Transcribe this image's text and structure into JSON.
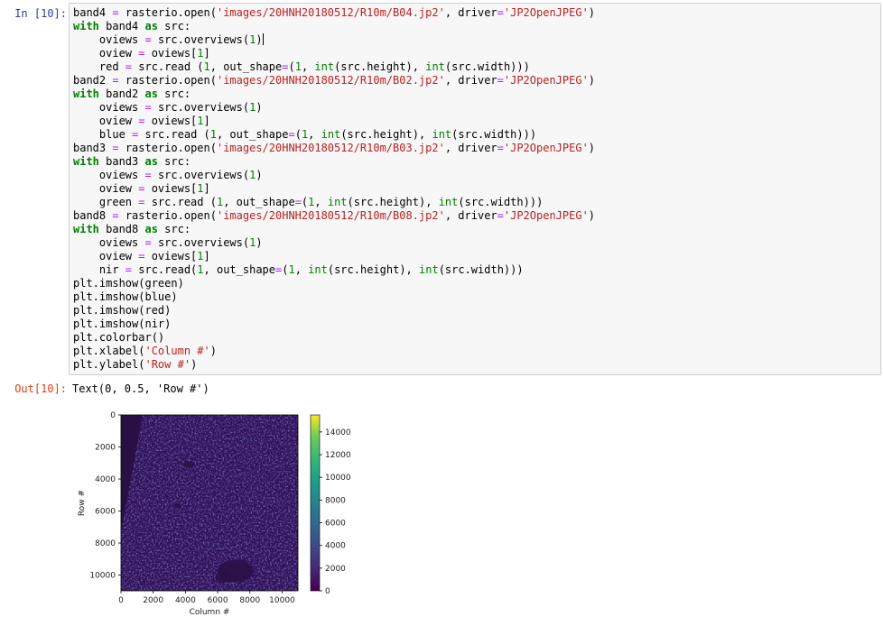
{
  "cell": {
    "in_prompt": "In [10]:",
    "out_prompt": "Out[10]:",
    "output_text": "Text(0, 0.5, 'Row #')",
    "code": [
      [
        [
          "",
          "band4 "
        ],
        [
          "o",
          "="
        ],
        [
          "",
          " rasterio.open("
        ],
        [
          "s",
          "'images/20HNH20180512/R10m/B04.jp2'"
        ],
        [
          "",
          ", driver"
        ],
        [
          "o",
          "="
        ],
        [
          "s",
          "'JP2OpenJPEG'"
        ],
        [
          "",
          ")"
        ]
      ],
      [
        [
          "k",
          "with"
        ],
        [
          "",
          " band4 "
        ],
        [
          "k",
          "as"
        ],
        [
          "",
          " src:"
        ]
      ],
      [
        [
          "",
          "    oviews "
        ],
        [
          "o",
          "="
        ],
        [
          "",
          " src.overviews("
        ],
        [
          "n",
          "1"
        ],
        [
          "",
          ")"
        ],
        [
          "cursor",
          ""
        ]
      ],
      [
        [
          "",
          "    oview "
        ],
        [
          "o",
          "="
        ],
        [
          "",
          " oviews["
        ],
        [
          "n",
          "1"
        ],
        [
          "",
          "]"
        ]
      ],
      [
        [
          "",
          "    red "
        ],
        [
          "o",
          "="
        ],
        [
          "",
          " src.read ("
        ],
        [
          "n",
          "1"
        ],
        [
          "",
          ", out_shape"
        ],
        [
          "o",
          "="
        ],
        [
          "",
          "("
        ],
        [
          "n",
          "1"
        ],
        [
          "",
          ", "
        ],
        [
          "b",
          "int"
        ],
        [
          "",
          "(src.height), "
        ],
        [
          "b",
          "int"
        ],
        [
          "",
          "(src.width)))"
        ]
      ],
      [
        [
          "",
          "band2 "
        ],
        [
          "o",
          "="
        ],
        [
          "",
          " rasterio.open("
        ],
        [
          "s",
          "'images/20HNH20180512/R10m/B02.jp2'"
        ],
        [
          "",
          ", driver"
        ],
        [
          "o",
          "="
        ],
        [
          "s",
          "'JP2OpenJPEG'"
        ],
        [
          "",
          ")"
        ]
      ],
      [
        [
          "k",
          "with"
        ],
        [
          "",
          " band2 "
        ],
        [
          "k",
          "as"
        ],
        [
          "",
          " src:"
        ]
      ],
      [
        [
          "",
          "    oviews "
        ],
        [
          "o",
          "="
        ],
        [
          "",
          " src.overviews("
        ],
        [
          "n",
          "1"
        ],
        [
          "",
          ")"
        ]
      ],
      [
        [
          "",
          "    oview "
        ],
        [
          "o",
          "="
        ],
        [
          "",
          " oviews["
        ],
        [
          "n",
          "1"
        ],
        [
          "",
          "]"
        ]
      ],
      [
        [
          "",
          "    blue "
        ],
        [
          "o",
          "="
        ],
        [
          "",
          " src.read ("
        ],
        [
          "n",
          "1"
        ],
        [
          "",
          ", out_shape"
        ],
        [
          "o",
          "="
        ],
        [
          "",
          "("
        ],
        [
          "n",
          "1"
        ],
        [
          "",
          ", "
        ],
        [
          "b",
          "int"
        ],
        [
          "",
          "(src.height), "
        ],
        [
          "b",
          "int"
        ],
        [
          "",
          "(src.width)))"
        ]
      ],
      [
        [
          "",
          "band3 "
        ],
        [
          "o",
          "="
        ],
        [
          "",
          " rasterio.open("
        ],
        [
          "s",
          "'images/20HNH20180512/R10m/B03.jp2'"
        ],
        [
          "",
          ", driver"
        ],
        [
          "o",
          "="
        ],
        [
          "s",
          "'JP2OpenJPEG'"
        ],
        [
          "",
          ")"
        ]
      ],
      [
        [
          "k",
          "with"
        ],
        [
          "",
          " band3 "
        ],
        [
          "k",
          "as"
        ],
        [
          "",
          " src:"
        ]
      ],
      [
        [
          "",
          "    oviews "
        ],
        [
          "o",
          "="
        ],
        [
          "",
          " src.overviews("
        ],
        [
          "n",
          "1"
        ],
        [
          "",
          ")"
        ]
      ],
      [
        [
          "",
          "    oview "
        ],
        [
          "o",
          "="
        ],
        [
          "",
          " oviews["
        ],
        [
          "n",
          "1"
        ],
        [
          "",
          "]"
        ]
      ],
      [
        [
          "",
          "    green "
        ],
        [
          "o",
          "="
        ],
        [
          "",
          " src.read ("
        ],
        [
          "n",
          "1"
        ],
        [
          "",
          ", out_shape"
        ],
        [
          "o",
          "="
        ],
        [
          "",
          "("
        ],
        [
          "n",
          "1"
        ],
        [
          "",
          ", "
        ],
        [
          "b",
          "int"
        ],
        [
          "",
          "(src.height), "
        ],
        [
          "b",
          "int"
        ],
        [
          "",
          "(src.width)))"
        ]
      ],
      [
        [
          "",
          "band8 "
        ],
        [
          "o",
          "="
        ],
        [
          "",
          " rasterio.open("
        ],
        [
          "s",
          "'images/20HNH20180512/R10m/B08.jp2'"
        ],
        [
          "",
          ", driver"
        ],
        [
          "o",
          "="
        ],
        [
          "s",
          "'JP2OpenJPEG'"
        ],
        [
          "",
          ")"
        ]
      ],
      [
        [
          "k",
          "with"
        ],
        [
          "",
          " band8 "
        ],
        [
          "k",
          "as"
        ],
        [
          "",
          " src:"
        ]
      ],
      [
        [
          "",
          "    oviews "
        ],
        [
          "o",
          "="
        ],
        [
          "",
          " src.overviews("
        ],
        [
          "n",
          "1"
        ],
        [
          "",
          ")"
        ]
      ],
      [
        [
          "",
          "    oview "
        ],
        [
          "o",
          "="
        ],
        [
          "",
          " oviews["
        ],
        [
          "n",
          "1"
        ],
        [
          "",
          "]"
        ]
      ],
      [
        [
          "",
          "    nir "
        ],
        [
          "o",
          "="
        ],
        [
          "",
          " src.read("
        ],
        [
          "n",
          "1"
        ],
        [
          "",
          ", out_shape"
        ],
        [
          "o",
          "="
        ],
        [
          "",
          "("
        ],
        [
          "n",
          "1"
        ],
        [
          "",
          ", "
        ],
        [
          "b",
          "int"
        ],
        [
          "",
          "(src.height), "
        ],
        [
          "b",
          "int"
        ],
        [
          "",
          "(src.width)))"
        ]
      ],
      [
        [
          "",
          "plt.imshow(green)"
        ]
      ],
      [
        [
          "",
          "plt.imshow(blue)"
        ]
      ],
      [
        [
          "",
          "plt.imshow(red)"
        ]
      ],
      [
        [
          "",
          "plt.imshow(nir)"
        ]
      ],
      [
        [
          "",
          "plt.colorbar()"
        ]
      ],
      [
        [
          "",
          "plt.xlabel("
        ],
        [
          "s",
          "'Column #'"
        ],
        [
          "",
          ")"
        ]
      ],
      [
        [
          "",
          "plt.ylabel("
        ],
        [
          "s",
          "'Row #'"
        ],
        [
          "",
          ")"
        ]
      ]
    ]
  },
  "chart_data": {
    "type": "heatmap",
    "xlabel": "Column #",
    "ylabel": "Row #",
    "xlim": [
      0,
      10980
    ],
    "ylim": [
      10980,
      0
    ],
    "x_ticks": [
      0,
      2000,
      4000,
      6000,
      8000,
      10000
    ],
    "y_ticks": [
      0,
      2000,
      4000,
      6000,
      8000,
      10000
    ],
    "colorbar": {
      "colormap": "viridis",
      "range": [
        0,
        15500
      ],
      "ticks": [
        0,
        2000,
        4000,
        6000,
        8000,
        10000,
        12000,
        14000
      ]
    },
    "colors": {
      "background_dark": "#2a0f45",
      "texture_mid": "#3b3f84",
      "texture_light": "#31688e"
    }
  }
}
